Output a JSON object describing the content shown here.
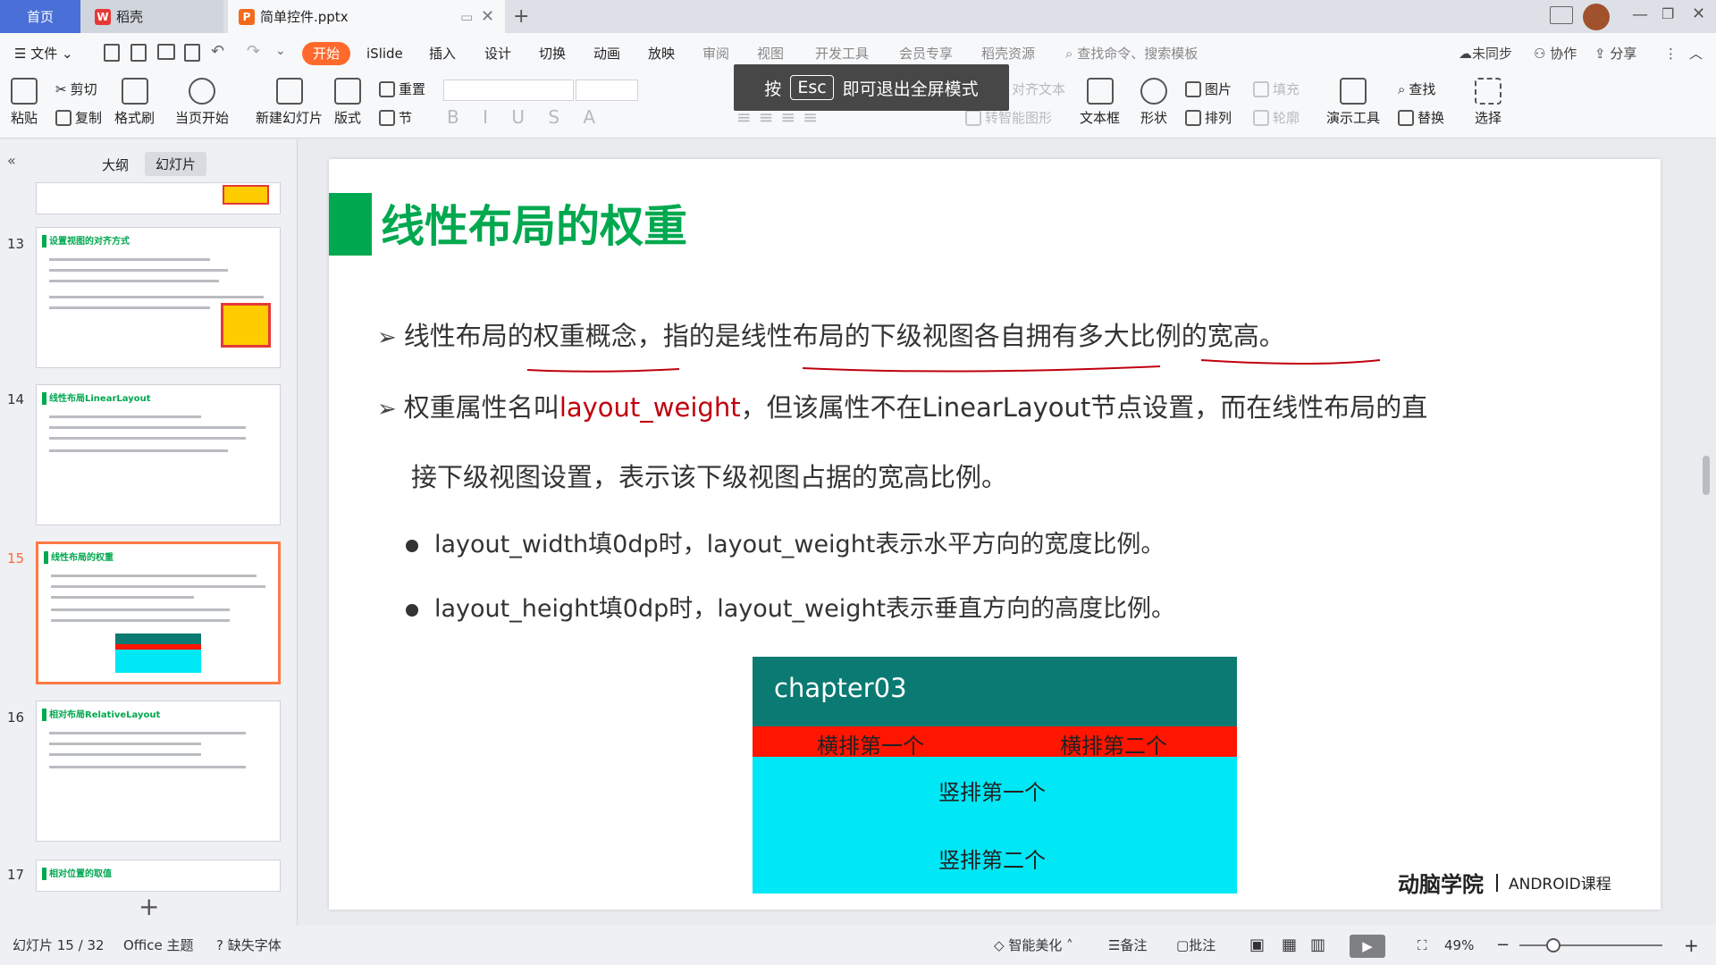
{
  "tabs": {
    "home": "首页",
    "doc1": "稻壳",
    "doc2": "简单控件.pptx",
    "new_tab": "+"
  },
  "menu": {
    "file": "文件",
    "start": "开始",
    "items": [
      "iSlide",
      "插入",
      "设计",
      "切换",
      "动画",
      "放映",
      "审阅",
      "视图",
      "开发工具",
      "会员专享",
      "稻壳资源"
    ],
    "search": "查找命令、搜索模板",
    "sync": "未同步",
    "collab": "协作",
    "share": "分享"
  },
  "toolbar": {
    "paste": "粘贴",
    "cut": "剪切",
    "copy": "复制",
    "format_painter": "格式刷",
    "from_current": "当页开始",
    "new_slide": "新建幻灯片",
    "layout": "版式",
    "reset": "重置",
    "section": "节",
    "textbox": "文本框",
    "shape": "形状",
    "picture": "图片",
    "fill": "填充",
    "arrange": "排列",
    "outline": "轮廓",
    "present_tools": "演示工具",
    "find": "查找",
    "replace": "替换",
    "select": "选择",
    "smart_shape": "转智能图形",
    "align_text": "对齐文本"
  },
  "esc_tip": {
    "pre": "按",
    "key": "Esc",
    "post": "即可退出全屏模式"
  },
  "panel": {
    "outline_tab": "大纲",
    "slides_tab": "幻灯片",
    "add": "+"
  },
  "thumbs": [
    {
      "num": "13",
      "title": "设置视图的对齐方式"
    },
    {
      "num": "14",
      "title": "线性布局LinearLayout"
    },
    {
      "num": "15",
      "title": "线性布局的权重"
    },
    {
      "num": "16",
      "title": "相对布局RelativeLayout"
    },
    {
      "num": "17",
      "title": "相对位置的取值"
    }
  ],
  "slide": {
    "title": "线性布局的权重",
    "b1": "线性布局的权重概念，指的是线性布局的下级视图各自拥有多大比例的宽高。",
    "b2_pre": "权重属性名叫",
    "b2_red": "layout_weight",
    "b2_post": "，但该属性不在LinearLayout节点设置，而在线性布局的直",
    "b2_cont": "接下级视图设置，表示该下级视图占据的宽高比例。",
    "b3": "layout_width填0dp时，layout_weight表示水平方向的宽度比例。",
    "b4": "layout_height填0dp时，layout_weight表示垂直方向的高度比例。",
    "demo": {
      "title": "chapter03",
      "h1": "横排第一个",
      "h2": "横排第二个",
      "v1": "竖排第一个",
      "v2": "竖排第二个"
    },
    "brand_logo": "动脑学院",
    "brand_text": "ANDROID课程"
  },
  "status": {
    "slide_count": "幻灯片 15 / 32",
    "theme": "Office 主题",
    "missing_font": "缺失字体",
    "beautify": "智能美化",
    "notes": "备注",
    "comments": "批注",
    "zoom": "49%"
  }
}
